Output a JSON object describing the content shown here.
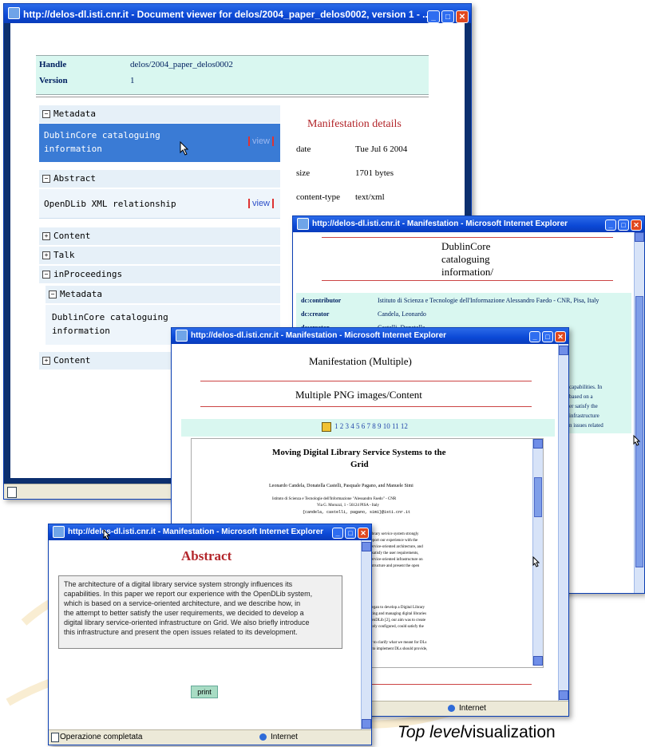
{
  "window_a": {
    "title": "http://delos-dl.isti.cnr.it - Document viewer for delos/2004_paper_delos0002, version 1 - ...",
    "handle_label": "Handle",
    "handle_value": "delos/2004_paper_delos0002",
    "version_label": "Version",
    "version_value": "1",
    "sections": {
      "metadata": "Metadata",
      "abstract": "Abstract",
      "content": "Content",
      "talk": "Talk",
      "inproceedings": "inProceedings",
      "sub_metadata": "Metadata",
      "sub_content": "Content"
    },
    "items": {
      "dc_line1": "DublinCore cataloguing",
      "dc_line2": "information",
      "opendlib": "OpenDLib XML relationship",
      "sub_dc_line1": "DublinCore cataloguing",
      "sub_dc_line2": "information",
      "view": "view"
    },
    "manifestation": {
      "heading": "Manifestation details",
      "rows": [
        {
          "label": "date",
          "value": "Tue Jul 6 2004"
        },
        {
          "label": "size",
          "value": "1701 bytes"
        },
        {
          "label": "content-type",
          "value": "text/xml"
        }
      ]
    }
  },
  "window_b": {
    "title": "http://delos-dl.isti.cnr.it - Manifestation - Microsoft Internet Explorer",
    "heading_line1": "DublinCore",
    "heading_line2": "cataloguing",
    "heading_line3": "information/",
    "rows": [
      {
        "label": "dc:contributor",
        "value": "Istituto di Scienza e Tecnologie dell'Informazione Alessandro Faedo - CNR, Pisa, Italy"
      },
      {
        "label": "dc:creator",
        "value": "Candela, Leonardo"
      },
      {
        "label": "dc:creator",
        "value": "Castelli, Donatella"
      }
    ],
    "side_text": [
      "capabilities. In",
      "based on a",
      "er satisfy the",
      "infrastructure",
      "n issues related"
    ]
  },
  "window_c": {
    "title": "http://delos-dl.isti.cnr.it - Manifestation - Microsoft Internet Explorer",
    "heading": "Manifestation (Multiple)",
    "subheading": "Multiple PNG images/Content",
    "pages": "1 2 3 4 5 6 7 8 9 10 11 12",
    "paper_title_1": "Moving Digital Library Service Systems to the",
    "paper_title_2": "Grid",
    "authors": "Leonardo Candela, Donatella Castelli, Pasquale Pagano, and Manuele Simi",
    "affil_1": "Istituto di Scienza e Tecnologie dell'Informazione \"Alessandro Faedo\" - CNR",
    "affil_2": "Via G. Moruzzi, 1 - 56124 PISA - Italy",
    "affil_3": "{candela, castelli, pagano, simi}@isti.cnr.it",
    "frag_1": [
      "library service system strongly",
      "report our experience with the",
      "service-oriented architecture, and",
      "r satisfy the user requirements,",
      "service-oriented infrastructure on",
      "astructure and present the open"
    ],
    "frag_2": [
      "began to develop a Digital Library",
      "ating and managing digital libraries",
      "penDLib [2], our aim was to create",
      "ately configured, could satisfy the",
      "",
      "w to clarify what we meant for DLs",
      "e to implement DLs should provide,"
    ],
    "status_zone": "Internet"
  },
  "window_d": {
    "title": "http://delos-dl.isti.cnr.it - Manifestation - Microsoft Internet Explorer",
    "heading": "Abstract",
    "abstract_lines": [
      "The architecture of a digital library service system strongly influences its",
      "capabilities. In this paper we report our experience with the OpenDLib system,",
      "which is based on a service-oriented architecture, and we describe how, in",
      "the attempt to better satisfy the user requirements, we decided to develop a",
      "digital library service-oriented infrastructure on Grid. We also briefly introduce",
      "this infrastructure and present the open issues related to its development."
    ],
    "print_label": "print",
    "status_text": "Operazione completata",
    "status_zone": "Internet"
  },
  "caption": {
    "italic": "Top level",
    "normal": "visualization"
  }
}
